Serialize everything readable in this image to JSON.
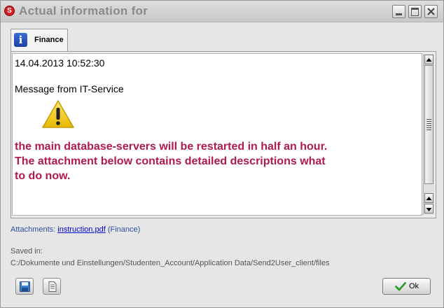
{
  "window": {
    "title": "Actual information for"
  },
  "tab": {
    "label": "Finance",
    "icon": "info-icon"
  },
  "message": {
    "timestamp": "14.04.2013 10:52:30",
    "from": "Message from IT-Service",
    "icon": "warning-icon",
    "lines": [
      "the main database-servers will be restarted in half an hour.",
      "The attachment below contains detailed descriptions what",
      "to do now."
    ],
    "color": "#b01b4a"
  },
  "attachments": {
    "label": "Attachments:",
    "file": "instruction.pdf",
    "category": "(Finance)"
  },
  "saved": {
    "label": "Saved in:",
    "path": "C:/Dokumente und Einstellungen/Studenten_Account/Application Data/Send2User_client/files"
  },
  "buttons": {
    "ok_label": "Ok"
  }
}
